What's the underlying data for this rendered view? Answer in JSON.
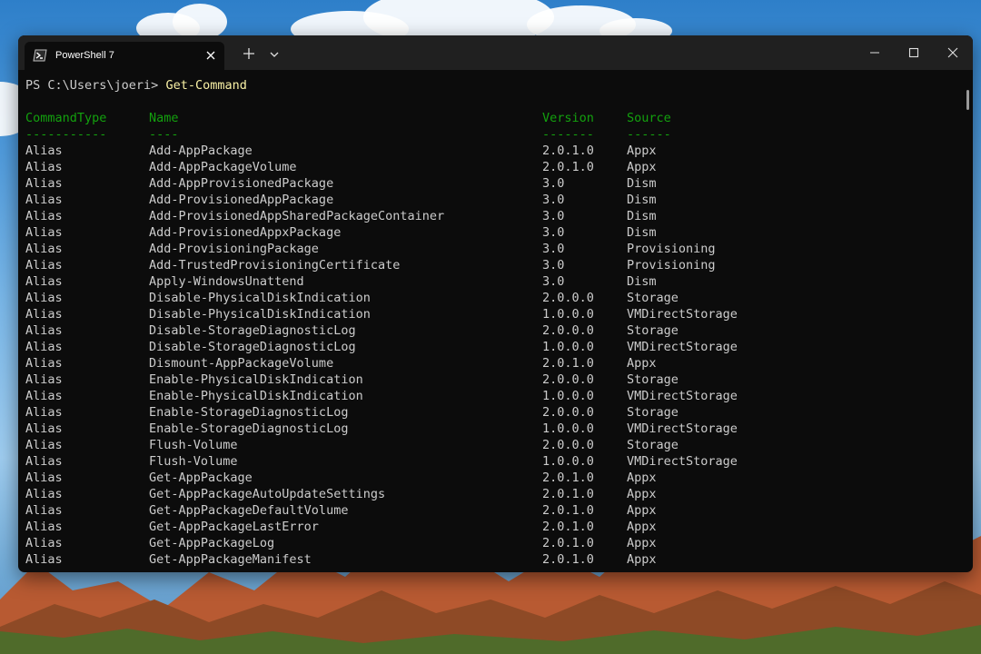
{
  "window": {
    "tab_title": "PowerShell 7",
    "icons": {
      "tab": "powershell-icon",
      "close_tab": "close-icon",
      "new_tab": "plus-icon",
      "dropdown": "chevron-down-icon",
      "minimize": "minimize-icon",
      "maximize": "maximize-icon",
      "close_window": "close-icon"
    }
  },
  "terminal": {
    "prompt": "PS C:\\Users\\joeri> ",
    "command": "Get-Command",
    "headers": [
      "CommandType",
      "Name",
      "Version",
      "Source"
    ],
    "separators": [
      "-----------",
      "----",
      "-------",
      "------"
    ],
    "rows": [
      [
        "Alias",
        "Add-AppPackage",
        "2.0.1.0",
        "Appx"
      ],
      [
        "Alias",
        "Add-AppPackageVolume",
        "2.0.1.0",
        "Appx"
      ],
      [
        "Alias",
        "Add-AppProvisionedPackage",
        "3.0",
        "Dism"
      ],
      [
        "Alias",
        "Add-ProvisionedAppPackage",
        "3.0",
        "Dism"
      ],
      [
        "Alias",
        "Add-ProvisionedAppSharedPackageContainer",
        "3.0",
        "Dism"
      ],
      [
        "Alias",
        "Add-ProvisionedAppxPackage",
        "3.0",
        "Dism"
      ],
      [
        "Alias",
        "Add-ProvisioningPackage",
        "3.0",
        "Provisioning"
      ],
      [
        "Alias",
        "Add-TrustedProvisioningCertificate",
        "3.0",
        "Provisioning"
      ],
      [
        "Alias",
        "Apply-WindowsUnattend",
        "3.0",
        "Dism"
      ],
      [
        "Alias",
        "Disable-PhysicalDiskIndication",
        "2.0.0.0",
        "Storage"
      ],
      [
        "Alias",
        "Disable-PhysicalDiskIndication",
        "1.0.0.0",
        "VMDirectStorage"
      ],
      [
        "Alias",
        "Disable-StorageDiagnosticLog",
        "2.0.0.0",
        "Storage"
      ],
      [
        "Alias",
        "Disable-StorageDiagnosticLog",
        "1.0.0.0",
        "VMDirectStorage"
      ],
      [
        "Alias",
        "Dismount-AppPackageVolume",
        "2.0.1.0",
        "Appx"
      ],
      [
        "Alias",
        "Enable-PhysicalDiskIndication",
        "2.0.0.0",
        "Storage"
      ],
      [
        "Alias",
        "Enable-PhysicalDiskIndication",
        "1.0.0.0",
        "VMDirectStorage"
      ],
      [
        "Alias",
        "Enable-StorageDiagnosticLog",
        "2.0.0.0",
        "Storage"
      ],
      [
        "Alias",
        "Enable-StorageDiagnosticLog",
        "1.0.0.0",
        "VMDirectStorage"
      ],
      [
        "Alias",
        "Flush-Volume",
        "2.0.0.0",
        "Storage"
      ],
      [
        "Alias",
        "Flush-Volume",
        "1.0.0.0",
        "VMDirectStorage"
      ],
      [
        "Alias",
        "Get-AppPackage",
        "2.0.1.0",
        "Appx"
      ],
      [
        "Alias",
        "Get-AppPackageAutoUpdateSettings",
        "2.0.1.0",
        "Appx"
      ],
      [
        "Alias",
        "Get-AppPackageDefaultVolume",
        "2.0.1.0",
        "Appx"
      ],
      [
        "Alias",
        "Get-AppPackageLastError",
        "2.0.1.0",
        "Appx"
      ],
      [
        "Alias",
        "Get-AppPackageLog",
        "2.0.1.0",
        "Appx"
      ],
      [
        "Alias",
        "Get-AppPackageManifest",
        "2.0.1.0",
        "Appx"
      ]
    ]
  },
  "colors": {
    "terminal_bg": "#0c0c0c",
    "titlebar_bg": "#202020",
    "text": "#cccccc",
    "header_green": "#13a10e",
    "command_yellow": "#f9f1a5"
  }
}
